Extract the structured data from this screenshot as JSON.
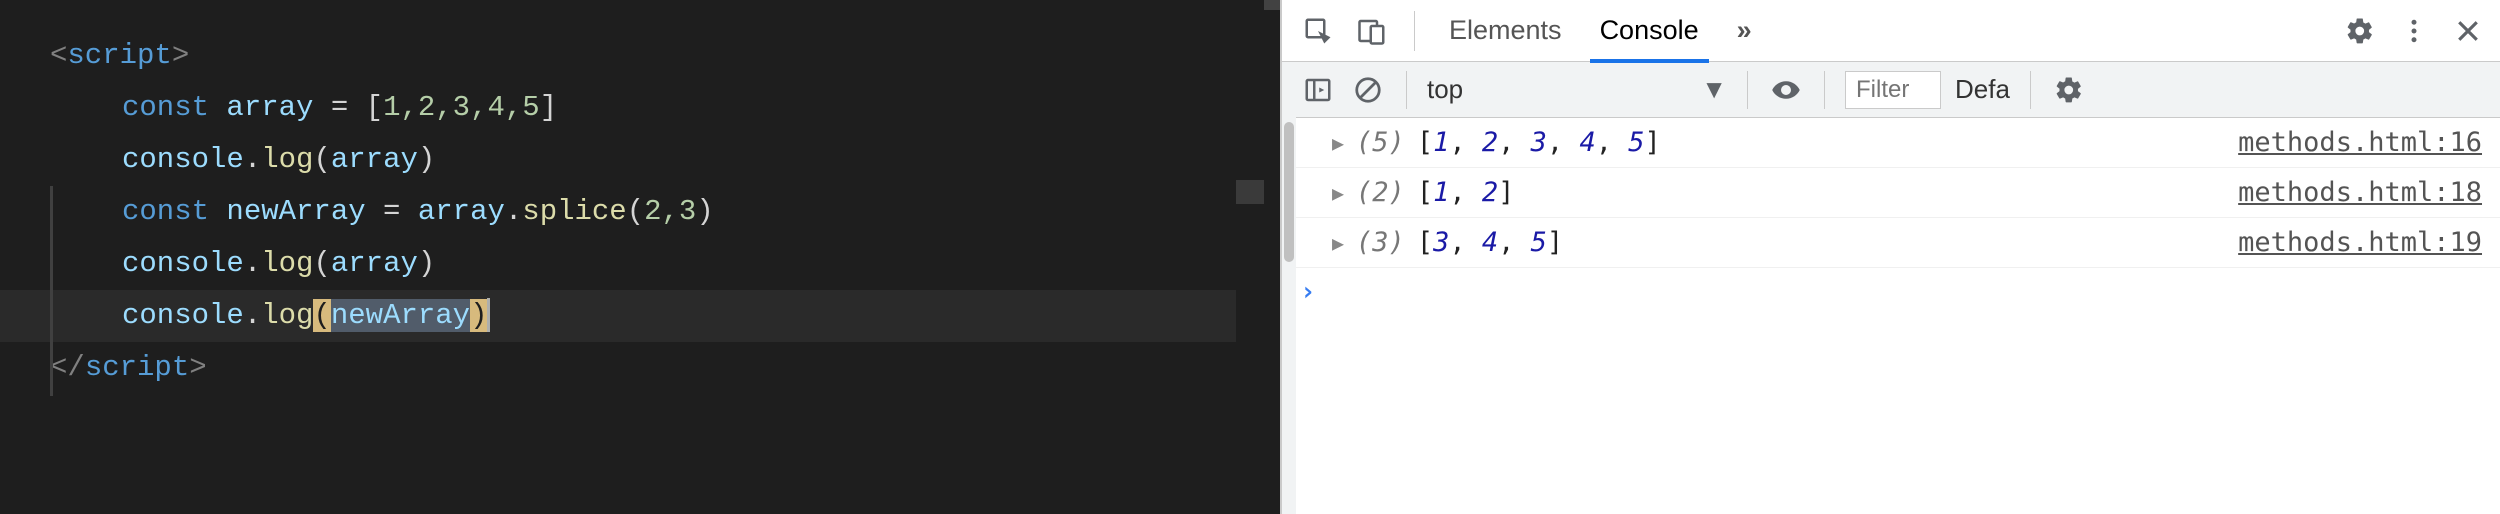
{
  "editor": {
    "code": {
      "open_tag_brackets": "<",
      "tag_name": "script",
      "close_bracket": ">",
      "line2_kw": "const",
      "line2_var": "array",
      "line2_op": " = ",
      "line2_arr_open": "[",
      "line2_nums": "1,2,3,4,5",
      "line2_arr_close": "]",
      "line3_obj": "console",
      "line3_dot": ".",
      "line3_fn": "log",
      "line3_open": "(",
      "line3_arg": "array",
      "line3_close": ")",
      "line4_kw": "const",
      "line4_var": "newArray",
      "line4_op": " = ",
      "line4_arr": "array",
      "line4_dot": ".",
      "line4_fn": "splice",
      "line4_open": "(",
      "line4_args": "2,3",
      "line4_close": ")",
      "line5_obj": "console",
      "line5_dot": ".",
      "line5_fn": "log",
      "line5_open": "(",
      "line5_arg": "array",
      "line5_close": ")",
      "line6_obj": "console",
      "line6_dot": ".",
      "line6_fn": "log",
      "line6_open": "(",
      "line6_arg": "newArray",
      "line6_close": ")",
      "close_tag_open": "</",
      "close_tag_name": "script",
      "close_tag_close": ">"
    }
  },
  "devtools": {
    "tabs": {
      "elements": "Elements",
      "console": "Console",
      "more": "»"
    },
    "toolbar": {
      "context": "top",
      "filter_placeholder": "Filter",
      "levels": "Defa"
    },
    "messages": [
      {
        "count": "(5)",
        "values": [
          "1",
          "2",
          "3",
          "4",
          "5"
        ],
        "source": "methods.html:16"
      },
      {
        "count": "(2)",
        "values": [
          "1",
          "2"
        ],
        "source": "methods.html:18"
      },
      {
        "count": "(3)",
        "values": [
          "3",
          "4",
          "5"
        ],
        "source": "methods.html:19"
      }
    ]
  }
}
